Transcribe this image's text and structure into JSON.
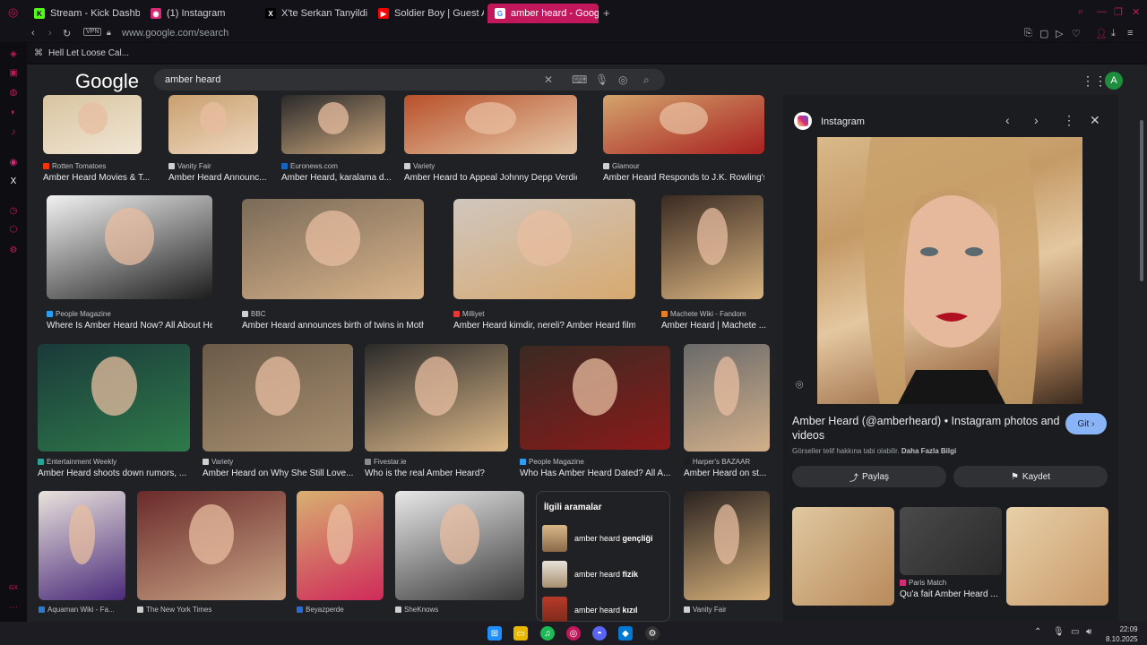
{
  "browser": {
    "tabs": [
      {
        "label": "Stream - Kick Dashboard",
        "color": "#53fc18"
      },
      {
        "label": "(1) Instagram",
        "color": "#d62976"
      },
      {
        "label": "X'te Serkan Tanyildizi: \"E",
        "color": "#000000"
      },
      {
        "label": "Soldier Boy | Guest Appe",
        "color": "#ff0000"
      },
      {
        "label": "amber heard - Google'da",
        "color": "#4285f4"
      }
    ],
    "url": "www.google.com/search",
    "vpn": "VPN",
    "bookmark": "Hell Let Loose Cal..."
  },
  "google": {
    "logo": "Google",
    "query": "amber heard",
    "avatar": "A"
  },
  "results": [
    {
      "source": "Rotten Tomatoes",
      "title": "Amber Heard Movies & T...",
      "icon_color": "#fa320a",
      "palette": [
        "#d8c4a0",
        "#f1e6d4"
      ]
    },
    {
      "source": "Vanity Fair",
      "title": "Amber Heard Announc...",
      "icon_color": "#cfcfcf",
      "palette": [
        "#c9a070",
        "#eed7bd"
      ]
    },
    {
      "source": "Euronews.com",
      "title": "Amber Heard, karalama d...",
      "icon_color": "#1565c0",
      "palette": [
        "#2a2a2a",
        "#c7a37a"
      ]
    },
    {
      "source": "Variety",
      "title": "Amber Heard to Appeal Johnny Depp Verdic...",
      "icon_color": "#cfcfcf",
      "palette": [
        "#b8502a",
        "#e6c9a8"
      ]
    },
    {
      "source": "Glamour",
      "title": "Amber Heard Responds to J.K. Rowling's...",
      "icon_color": "#cfcfcf",
      "palette": [
        "#d4a46c",
        "#a82020"
      ]
    },
    {
      "source": "People Magazine",
      "title": "Where Is Amber Heard Now? All About Her ...",
      "icon_color": "#2a9df4",
      "palette": [
        "#f2f2f2",
        "#1d1d1d"
      ]
    },
    {
      "source": "BBC",
      "title": "Amber Heard announces birth of twins in Mother...",
      "icon_color": "#cfcfcf",
      "palette": [
        "#7a6a58",
        "#d9b48a"
      ]
    },
    {
      "source": "Milliyet",
      "title": "Amber Heard kimdir, nereli? Amber Heard filmler...",
      "icon_color": "#e53935",
      "palette": [
        "#d0c6be",
        "#d7a96f"
      ]
    },
    {
      "source": "Machete Wiki - Fandom",
      "title": "Amber Heard | Machete ...",
      "icon_color": "#e67e22",
      "palette": [
        "#3a2a22",
        "#d9b480"
      ]
    },
    {
      "source": "Entertainment Weekly",
      "title": "Amber Heard shoots down rumors, ...",
      "icon_color": "#26a69a",
      "palette": [
        "#1a3a3a",
        "#2f7a4a"
      ]
    },
    {
      "source": "Variety",
      "title": "Amber Heard on Why She Still Love...",
      "icon_color": "#cfcfcf",
      "palette": [
        "#6a5a48",
        "#a89070"
      ]
    },
    {
      "source": "Fivestar.ie",
      "title": "Who is the real Amber Heard?",
      "icon_color": "#8a8a8a",
      "palette": [
        "#2a2a2a",
        "#dcb888"
      ]
    },
    {
      "source": "People Magazine",
      "title": "Who Has Amber Heard Dated? All A...",
      "icon_color": "#2a9df4",
      "palette": [
        "#3a2a22",
        "#8a1a1a"
      ]
    },
    {
      "source": "Harper's BAZAAR",
      "title": "Amber Heard on st...",
      "icon_color": "#1d1d1d",
      "palette": [
        "#6a6a6a",
        "#d2b08a"
      ]
    },
    {
      "source": "Aquaman Wiki - Fa...",
      "title": "",
      "icon_color": "#2a7ad4",
      "palette": [
        "#e9e3dc",
        "#4a2a7a"
      ]
    },
    {
      "source": "The New York Times",
      "title": "",
      "icon_color": "#cfcfcf",
      "palette": [
        "#6a2a2a",
        "#c9a485"
      ]
    },
    {
      "source": "Beyazperde",
      "title": "",
      "icon_color": "#2a6ad4",
      "palette": [
        "#d8b070",
        "#cf2a5a"
      ]
    },
    {
      "source": "SheKnows",
      "title": "",
      "icon_color": "#cfcfcf",
      "palette": [
        "#e8e8e8",
        "#3a3a3a"
      ]
    },
    {
      "source": "Vanity Fair",
      "title": "",
      "icon_color": "#cfcfcf",
      "palette": [
        "#2a2220",
        "#d6b07a"
      ]
    }
  ],
  "related": {
    "heading": "İlgili aramalar",
    "items": [
      {
        "prefix": "amber heard ",
        "bold": "gençliği"
      },
      {
        "prefix": "amber heard ",
        "bold": "fizik"
      },
      {
        "prefix": "amber heard ",
        "bold": "kızıl"
      }
    ]
  },
  "panel": {
    "site": "Instagram",
    "title": "Amber Heard (@amberheard) • Instagram photos and videos",
    "visit": "Git",
    "copyright": "Görseller telif hakkına tabi olabilir.",
    "learn_more": "Daha Fazla Bilgi",
    "share": "Paylaş",
    "save": "Kaydet",
    "related_source": "Paris Match",
    "related_title": "Qu'a fait Amber Heard ..."
  },
  "taskbar": {
    "time": "22:09",
    "date": "8.10.2025"
  }
}
